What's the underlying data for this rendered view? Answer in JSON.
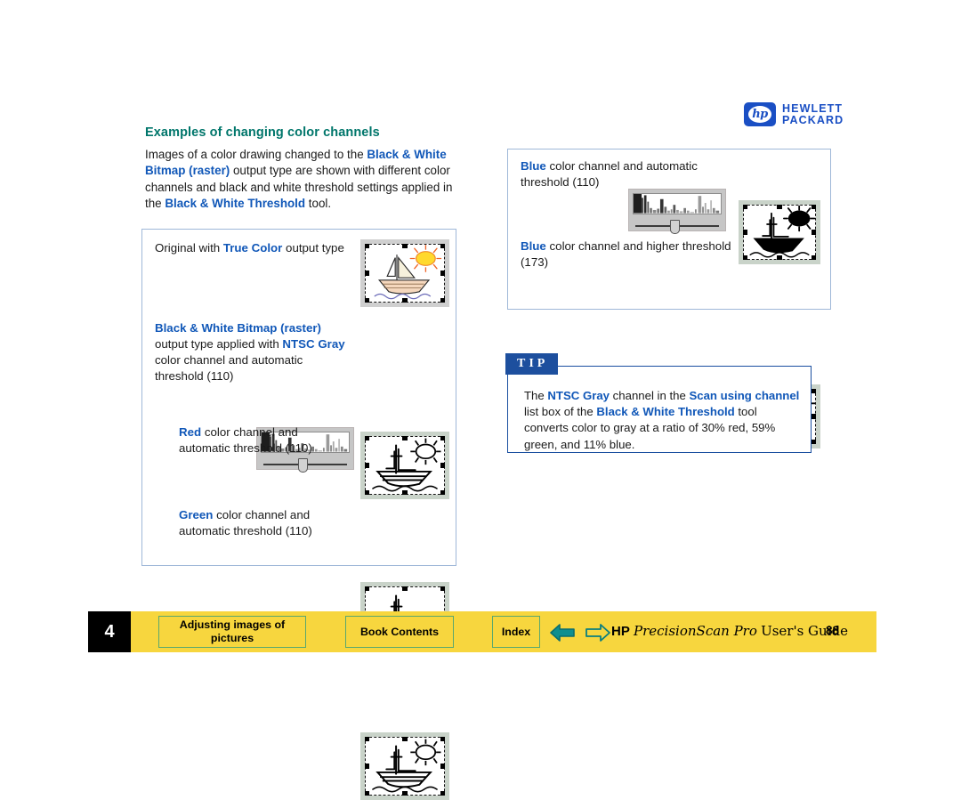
{
  "logo": {
    "mark_text": "hp",
    "line1": "HEWLETT",
    "line2": "PACKARD",
    "color": "#1a4fc4"
  },
  "heading": "Examples of changing color channels",
  "heading_color": "#00766b",
  "accent_blue": "#1057b8",
  "intro": {
    "p1": "Images of a color drawing changed to the ",
    "em1": "Black & White Bitmap (raster)",
    "p2": " output type are shown with different color channels and black and white threshold settings applied in the ",
    "em2": "Black & White Threshold",
    "p3": " tool."
  },
  "left_panel": {
    "rows": [
      {
        "em": "True Color",
        "pre": "Original with ",
        "post": " output type",
        "caption_full": "Original with True Color output type",
        "thumb": "color-sailboat-thumbnail"
      },
      {
        "em_lead": "Black & White Bitmap (raster)",
        "mid": " output type applied with ",
        "em2": "NTSC Gray",
        "post": " color channel and automatic threshold (110)",
        "caption_full": "Black & White Bitmap (raster) output type applied with NTSC Gray color channel and automatic threshold (110)",
        "threshold": "110",
        "thumb": "bw-sailboat-thumbnail",
        "histogram": true
      },
      {
        "em": "Red",
        "pre": "",
        "post": " color channel and automatic threshold (110)",
        "caption_full": "Red color channel and automatic threshold (110)",
        "threshold": "110",
        "thumb": "bw-sailboat-nosun-thumbnail"
      },
      {
        "em": "Green",
        "pre": "",
        "post": " color channel and automatic threshold (110)",
        "caption_full": "Green color channel and automatic threshold (110)",
        "threshold": "110",
        "thumb": "bw-sailboat-thumbnail"
      }
    ]
  },
  "right_panel": {
    "rows": [
      {
        "em": "Blue",
        "post": " color channel and automatic threshold (110)",
        "caption_full": "Blue color channel and automatic threshold (110)",
        "threshold": "110",
        "thumb": "bw-solid-sailboat-thumbnail",
        "histogram": true
      },
      {
        "em": "Blue",
        "post": " color channel and higher threshold (173)",
        "caption_full": "Blue color channel and higher threshold (173)",
        "threshold": "173",
        "thumb": "bw-solid-sailboat-thumbnail",
        "histogram": true
      }
    ]
  },
  "tip": {
    "badge": "TIP",
    "t1": "The ",
    "em1": "NTSC Gray",
    "t2": " channel in the ",
    "em2": "Scan using channel",
    "t3": " list box of the ",
    "em3": "Black & White Threshold",
    "t4": " tool converts color to gray at a ratio of 30% red, 59% green, and 11% blue.",
    "full": "The NTSC Gray channel in the Scan using channel list box of the Black & White Threshold tool converts color to gray at a ratio of 30% red, 59% green, and 11% blue.",
    "border_color": "#1a4fa0",
    "badge_bg": "#1d4f9e"
  },
  "footer": {
    "chapter": "4",
    "bar_color": "#f7d63e",
    "button_border": "#5aa86e",
    "btn_adjusting": "Adjusting images of pictures",
    "btn_contents": "Book Contents",
    "btn_index": "Index",
    "prev_icon": "left-arrow-icon",
    "next_icon": "right-arrow-icon",
    "brand": "HP",
    "product": "PrecisionScan Pro",
    "guide": "User's Guide",
    "page_number": "88"
  }
}
